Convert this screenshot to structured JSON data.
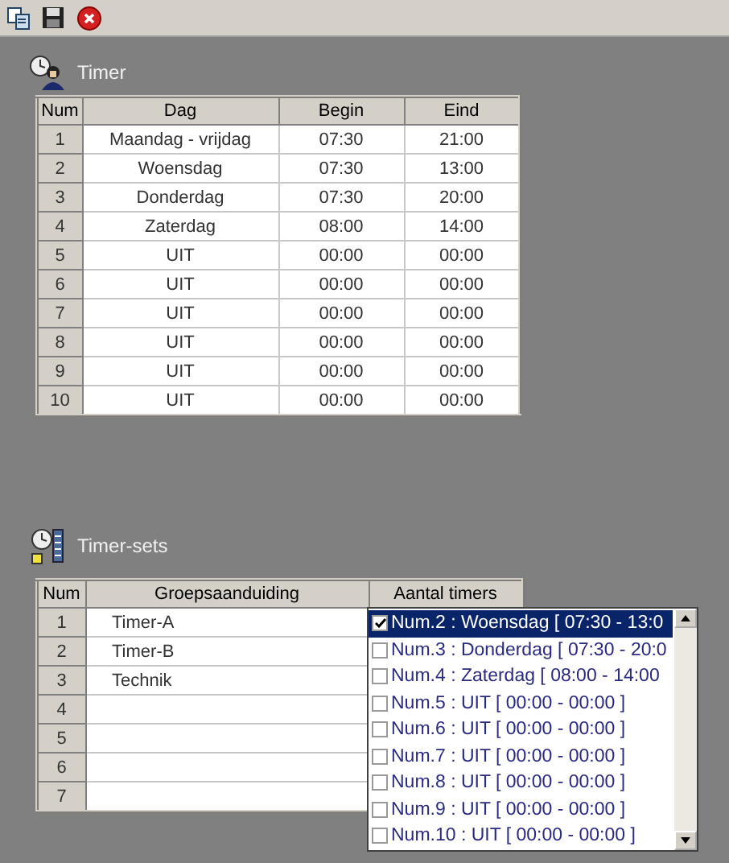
{
  "timer": {
    "title": "Timer",
    "columns": [
      "Num",
      "Dag",
      "Begin",
      "Eind"
    ],
    "rows": [
      [
        "1",
        "Maandag - vrijdag",
        "07:30",
        "21:00"
      ],
      [
        "2",
        "Woensdag",
        "07:30",
        "13:00"
      ],
      [
        "3",
        "Donderdag",
        "07:30",
        "20:00"
      ],
      [
        "4",
        "Zaterdag",
        "08:00",
        "14:00"
      ],
      [
        "5",
        "UIT",
        "00:00",
        "00:00"
      ],
      [
        "6",
        "UIT",
        "00:00",
        "00:00"
      ],
      [
        "7",
        "UIT",
        "00:00",
        "00:00"
      ],
      [
        "8",
        "UIT",
        "00:00",
        "00:00"
      ],
      [
        "9",
        "UIT",
        "00:00",
        "00:00"
      ],
      [
        "10",
        "UIT",
        "00:00",
        "00:00"
      ]
    ]
  },
  "timer_sets": {
    "title": "Timer-sets",
    "columns": [
      "Num",
      "Groepsaanduiding",
      "Aantal timers"
    ],
    "rows": [
      [
        "1",
        "Timer-A"
      ],
      [
        "2",
        "Timer-B"
      ],
      [
        "3",
        "Technik"
      ],
      [
        "4"
      ],
      [
        "5"
      ],
      [
        "6"
      ],
      [
        "7"
      ]
    ],
    "dropdown": {
      "items": [
        {
          "label": "Num.2 :  Woensdag [ 07:30 - 13:0",
          "checked": true,
          "selected": true
        },
        {
          "label": "Num.3 :  Donderdag [ 07:30 - 20:0",
          "checked": false,
          "selected": false
        },
        {
          "label": "Num.4 :  Zaterdag [ 08:00 - 14:00",
          "checked": false,
          "selected": false
        },
        {
          "label": "Num.5 :  UIT [ 00:00 - 00:00 ]",
          "checked": false,
          "selected": false
        },
        {
          "label": "Num.6 :  UIT [ 00:00 - 00:00 ]",
          "checked": false,
          "selected": false
        },
        {
          "label": "Num.7 :  UIT [ 00:00 - 00:00 ]",
          "checked": false,
          "selected": false
        },
        {
          "label": "Num.8 :  UIT [ 00:00 - 00:00 ]",
          "checked": false,
          "selected": false
        },
        {
          "label": "Num.9 :  UIT [ 00:00 - 00:00 ]",
          "checked": false,
          "selected": false
        },
        {
          "label": "Num.10 :  UIT [ 00:00 - 00:00 ]",
          "checked": false,
          "selected": false
        }
      ]
    }
  }
}
